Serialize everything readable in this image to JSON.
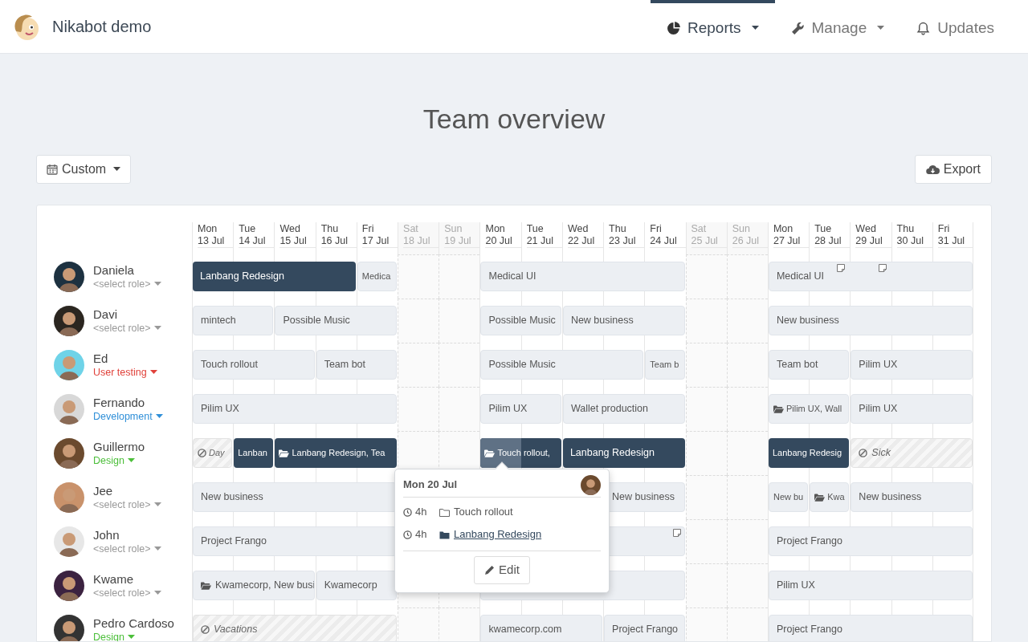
{
  "app": {
    "name": "Nikabot demo"
  },
  "nav": [
    {
      "label": "Reports",
      "selected": true,
      "dropdown": true
    },
    {
      "label": "Manage",
      "selected": false,
      "dropdown": true
    },
    {
      "label": "Updates",
      "selected": false,
      "dropdown": false
    }
  ],
  "page_title": "Team overview",
  "range_button": "Custom",
  "export_button": "Export",
  "days": [
    {
      "weekday": "Mon",
      "date": "13 Jul",
      "weekend": false
    },
    {
      "weekday": "Tue",
      "date": "14 Jul",
      "weekend": false
    },
    {
      "weekday": "Wed",
      "date": "15 Jul",
      "weekend": false
    },
    {
      "weekday": "Thu",
      "date": "16 Jul",
      "weekend": false
    },
    {
      "weekday": "Fri",
      "date": "17 Jul",
      "weekend": false
    },
    {
      "weekday": "Sat",
      "date": "18 Jul",
      "weekend": true
    },
    {
      "weekday": "Sun",
      "date": "19 Jul",
      "weekend": true
    },
    {
      "weekday": "Mon",
      "date": "20 Jul",
      "weekend": false
    },
    {
      "weekday": "Tue",
      "date": "21 Jul",
      "weekend": false
    },
    {
      "weekday": "Wed",
      "date": "22 Jul",
      "weekend": false
    },
    {
      "weekday": "Thu",
      "date": "23 Jul",
      "weekend": false
    },
    {
      "weekday": "Fri",
      "date": "24 Jul",
      "weekend": false
    },
    {
      "weekday": "Sat",
      "date": "25 Jul",
      "weekend": true
    },
    {
      "weekday": "Sun",
      "date": "26 Jul",
      "weekend": true
    },
    {
      "weekday": "Mon",
      "date": "27 Jul",
      "weekend": false
    },
    {
      "weekday": "Tue",
      "date": "28 Jul",
      "weekend": false
    },
    {
      "weekday": "Wed",
      "date": "29 Jul",
      "weekend": false
    },
    {
      "weekday": "Thu",
      "date": "30 Jul",
      "weekend": false
    },
    {
      "weekday": "Fri",
      "date": "31 Jul",
      "weekend": false
    }
  ],
  "people": [
    {
      "name": "Daniela",
      "role": {
        "text": "<select role>",
        "color": "#999999"
      },
      "bars": [
        {
          "label": "Lanbang Redesign",
          "kind": "project",
          "filled": true
        },
        {
          "label": "Medica",
          "kind": "project",
          "filled": false
        },
        {
          "label": "Medical UI",
          "kind": "project",
          "filled": false
        },
        {
          "label": "Medical UI",
          "kind": "project",
          "filled": false
        }
      ]
    },
    {
      "name": "Davi",
      "role": {
        "text": "<select role>",
        "color": "#999999"
      },
      "bars": [
        {
          "label": "mintech",
          "kind": "project",
          "filled": false
        },
        {
          "label": "Possible Music",
          "kind": "project",
          "filled": false
        },
        {
          "label": "Possible Music",
          "kind": "project",
          "filled": false
        },
        {
          "label": "New business",
          "kind": "project",
          "filled": false
        },
        {
          "label": "New business",
          "kind": "project",
          "filled": false
        }
      ]
    },
    {
      "name": "Ed",
      "role": {
        "text": "User testing",
        "color": "#e0413a"
      },
      "bars": [
        {
          "label": "Touch rollout",
          "kind": "project",
          "filled": false
        },
        {
          "label": "Team bot",
          "kind": "project",
          "filled": false
        },
        {
          "label": "Possible Music",
          "kind": "project",
          "filled": false
        },
        {
          "label": "Team b",
          "kind": "project",
          "filled": false
        },
        {
          "label": "Team bot",
          "kind": "project",
          "filled": false
        },
        {
          "label": "Pilim UX",
          "kind": "project",
          "filled": false
        }
      ]
    },
    {
      "name": "Fernando",
      "role": {
        "text": "Development",
        "color": "#2f8fd8"
      },
      "bars": [
        {
          "label": "Pilim UX",
          "kind": "project",
          "filled": false
        },
        {
          "label": "Pilim UX",
          "kind": "project",
          "filled": false
        },
        {
          "label": "Wallet production",
          "kind": "project",
          "filled": false
        },
        {
          "label": "Pilim UX, Wall",
          "kind": "group",
          "filled": false
        },
        {
          "label": "Pilim UX",
          "kind": "project",
          "filled": false
        }
      ]
    },
    {
      "name": "Guillermo",
      "role": {
        "text": "Design",
        "color": "#4cbf3a"
      },
      "bars": [
        {
          "label": "Day",
          "kind": "absence"
        },
        {
          "label": "Lanban",
          "kind": "project",
          "filled": true
        },
        {
          "label": "Lanbang Redesign, Tea",
          "kind": "group",
          "filled": true
        },
        {
          "label": "Touch rollout,",
          "kind": "group",
          "filled": true
        },
        {
          "label": "Lanbang Redesign",
          "kind": "project",
          "filled": true
        },
        {
          "label": "Lanbang Redesig",
          "kind": "project",
          "filled": true
        },
        {
          "label": "Sick",
          "kind": "absence"
        }
      ]
    },
    {
      "name": "Jee",
      "role": {
        "text": "<select role>",
        "color": "#999999"
      },
      "bars": [
        {
          "label": "New business",
          "kind": "project",
          "filled": false
        },
        {
          "label": "New business",
          "kind": "project",
          "filled": false
        },
        {
          "label": "New bu",
          "kind": "project",
          "filled": false
        },
        {
          "label": "Kwa",
          "kind": "group",
          "filled": false
        },
        {
          "label": "New business",
          "kind": "project",
          "filled": false
        }
      ]
    },
    {
      "name": "John",
      "role": {
        "text": "<select role>",
        "color": "#999999"
      },
      "bars": [
        {
          "label": "Project Frango",
          "kind": "project",
          "filled": false
        },
        {
          "kind": "project",
          "filled": false
        },
        {
          "label": "Project Frango",
          "kind": "project",
          "filled": false
        }
      ]
    },
    {
      "name": "Kwame",
      "role": {
        "text": "<select role>",
        "color": "#999999"
      },
      "bars": [
        {
          "label": "Kwamecorp, New busi",
          "kind": "group",
          "filled": false
        },
        {
          "label": "Kwamecorp",
          "kind": "project",
          "filled": false
        },
        {
          "kind": "project",
          "filled": false
        },
        {
          "label": "Pilim UX",
          "kind": "project",
          "filled": false
        }
      ]
    },
    {
      "name": "Pedro Cardoso",
      "role": {
        "text": "Design",
        "color": "#4cbf3a"
      },
      "bars": [
        {
          "label": "Vacations",
          "kind": "absence"
        },
        {
          "label": "kwamecorp.com",
          "kind": "project",
          "filled": false
        },
        {
          "label": "Project Frango",
          "kind": "project",
          "filled": false
        },
        {
          "label": "Project Frango",
          "kind": "project",
          "filled": false
        }
      ]
    }
  ],
  "popover": {
    "title": "Mon 20 Jul",
    "entries": [
      {
        "hours": "4h",
        "project": "Touch rollout",
        "link": false
      },
      {
        "hours": "4h",
        "project": "Lanbang Redesign",
        "link": true
      }
    ],
    "edit_button": "Edit"
  }
}
